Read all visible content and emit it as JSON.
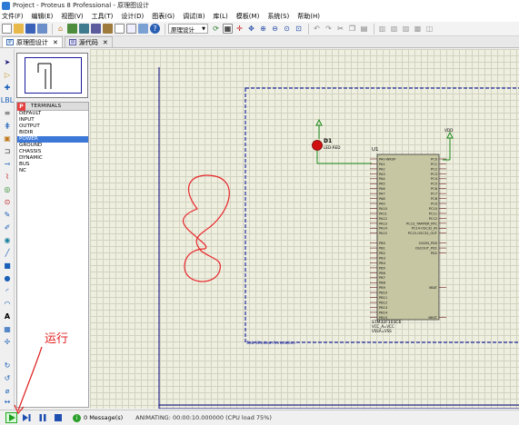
{
  "window": {
    "title": "Project - Proteus 8 Professional - 原理图设计"
  },
  "menu": [
    "文件(F)",
    "编辑(E)",
    "视图(V)",
    "工具(T)",
    "设计(D)",
    "图表(G)",
    "调试(B)",
    "库(L)",
    "模板(M)",
    "系统(S)",
    "帮助(H)"
  ],
  "toolbar": {
    "mode_select": "原理设计"
  },
  "tabs": [
    {
      "label": "原理图设计",
      "close": "✕"
    },
    {
      "label": "源代码",
      "close": "✕"
    }
  ],
  "device_panel": {
    "header_icon": "P",
    "title": "TERMINALS",
    "items": [
      "DEFAULT",
      "INPUT",
      "OUTPUT",
      "BIDIR",
      "POWER",
      "GROUND",
      "CHASSIS",
      "DYNAMIC",
      "BUS",
      "NC"
    ],
    "selected": "POWER"
  },
  "schematic": {
    "chip_ref": "U1",
    "chip_name": "STM32F103C6",
    "chip_props": [
      "VCC_A=VCC",
      "VSSA=VSS"
    ],
    "led_ref": "D1",
    "led_name": "LED-RED",
    "power_label": "VDD",
    "left_pins": [
      "PA0-WKUP",
      "PA1",
      "PA2",
      "PA3",
      "PA4",
      "PA5",
      "PA6",
      "PA7",
      "PA8",
      "PA9",
      "PA10",
      "PA11",
      "PA12",
      "PA13",
      "PA14",
      "PA15",
      "",
      "PB0",
      "PB1",
      "PB2",
      "PB3",
      "PB4",
      "PB5",
      "PB6",
      "PB7",
      "PB8",
      "PB9",
      "PB10",
      "PB11",
      "PB12",
      "PB13",
      "PB14",
      "PB15"
    ],
    "right_pins": [
      "PC0",
      "PC1",
      "PC2",
      "PC3",
      "PC4",
      "PC5",
      "PC6",
      "PC7",
      "PC8",
      "PC9",
      "PC10",
      "PC11",
      "PC12",
      "PC13_TAMPER_RTC",
      "PC14-OSC32_IN",
      "PC15-OSC32_OUT",
      "",
      "OSCIN_PD0",
      "OSCOUT_PD1",
      "PD2",
      "",
      "",
      "",
      "",
      "",
      "",
      "VBAT",
      "",
      "",
      "",
      "",
      "",
      "NRST"
    ],
    "frame_label": "Sub Window Annotation"
  },
  "statusbar": {
    "messages": "0 Message(s)",
    "animating": "ANIMATING: 00:00:10.000000 (CPU load 75%)"
  },
  "annotation": {
    "label": "运行"
  }
}
